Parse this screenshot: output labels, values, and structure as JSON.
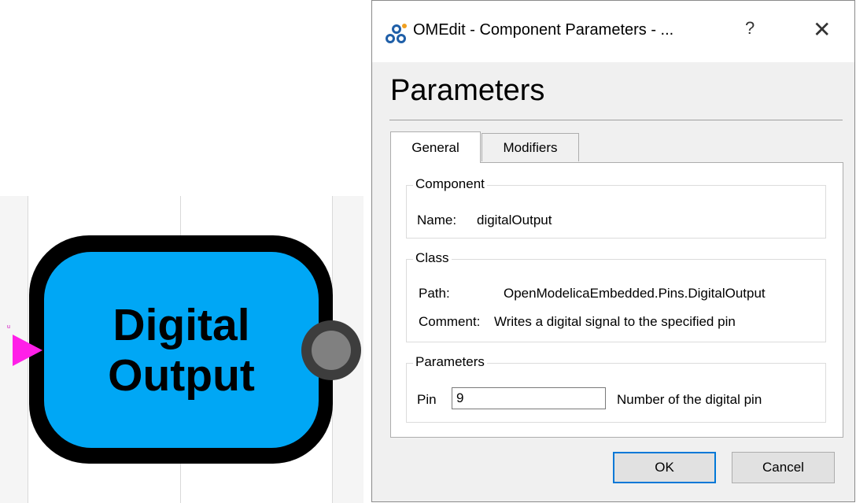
{
  "diagram": {
    "block_text_line1": "Digital",
    "block_text_line2": "Output",
    "input_port_label": "u",
    "colors": {
      "outer": "#000000",
      "inner": "#00a7f5",
      "input_port": "#ff1fe8",
      "output_port": "#808080"
    }
  },
  "dialog": {
    "window_title": "OMEdit - Component Parameters - ...",
    "help_label": "?",
    "close_label": "✕",
    "heading": "Parameters",
    "tabs": [
      {
        "label": "General",
        "active": true
      },
      {
        "label": "Modifiers",
        "active": false
      }
    ],
    "component_group": {
      "title": "Component",
      "name_label": "Name:",
      "name_value": "digitalOutput"
    },
    "class_group": {
      "title": "Class",
      "path_label": "Path:",
      "path_value": "OpenModelicaEmbedded.Pins.DigitalOutput",
      "comment_label": "Comment:",
      "comment_value": "Writes a digital signal to the specified pin"
    },
    "parameters_group": {
      "title": "Parameters",
      "pin_label": "Pin",
      "pin_value": "9",
      "pin_description": "Number of the digital pin"
    },
    "buttons": {
      "ok": "OK",
      "cancel": "Cancel"
    }
  }
}
